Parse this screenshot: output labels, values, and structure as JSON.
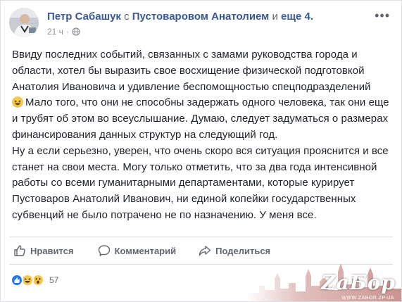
{
  "post": {
    "author": "Петр Сабашук",
    "with_prefix": "с",
    "tagged_person": "Пустоваровом Анатолием",
    "and_word": "и",
    "others": "еще 4.",
    "time": "21 ч",
    "privacy_icon": "globe-icon",
    "paragraph1_before_emoji": "Ввиду последних событий, связанных с замами руководства города и области, хотел бы выразить свое восхищение физической подготовкой Анатолия Ивановича и удивление беспомощностью спецподразделений",
    "paragraph1_after_emoji": "Мало того, что они не способны задержать одного человека, так они еще и трубят об этом во всеуслышание. Думаю, следует задуматься о размерах финансирования данных структур на следующий год.",
    "paragraph2": "Ну а если серьезно, уверен, что очень скоро вся ситуация прояснится и все станет на свои места. Могу только отметить, что за два года интенсивной работы со всеми гуманитарными департаментами, которые курирует Пустоваров Анатолий Иванович, ни единой копейки государственных субвенций не было потрачено не по назначению. У меня все."
  },
  "actions": {
    "like": "Нравится",
    "comment": "Комментарий",
    "share": "Поделиться"
  },
  "reactions": {
    "icons": [
      "like-icon",
      "haha-icon",
      "wow-icon"
    ],
    "count": "57"
  },
  "watermark": {
    "brand": "ZaБор",
    "url": "WWW.ZABOR.ZP.UA"
  },
  "colors": {
    "link": "#385898",
    "text": "#1d2129",
    "muted": "#606770",
    "like_blue": "#2078f4",
    "emoji_yellow": "#f7c94b"
  }
}
